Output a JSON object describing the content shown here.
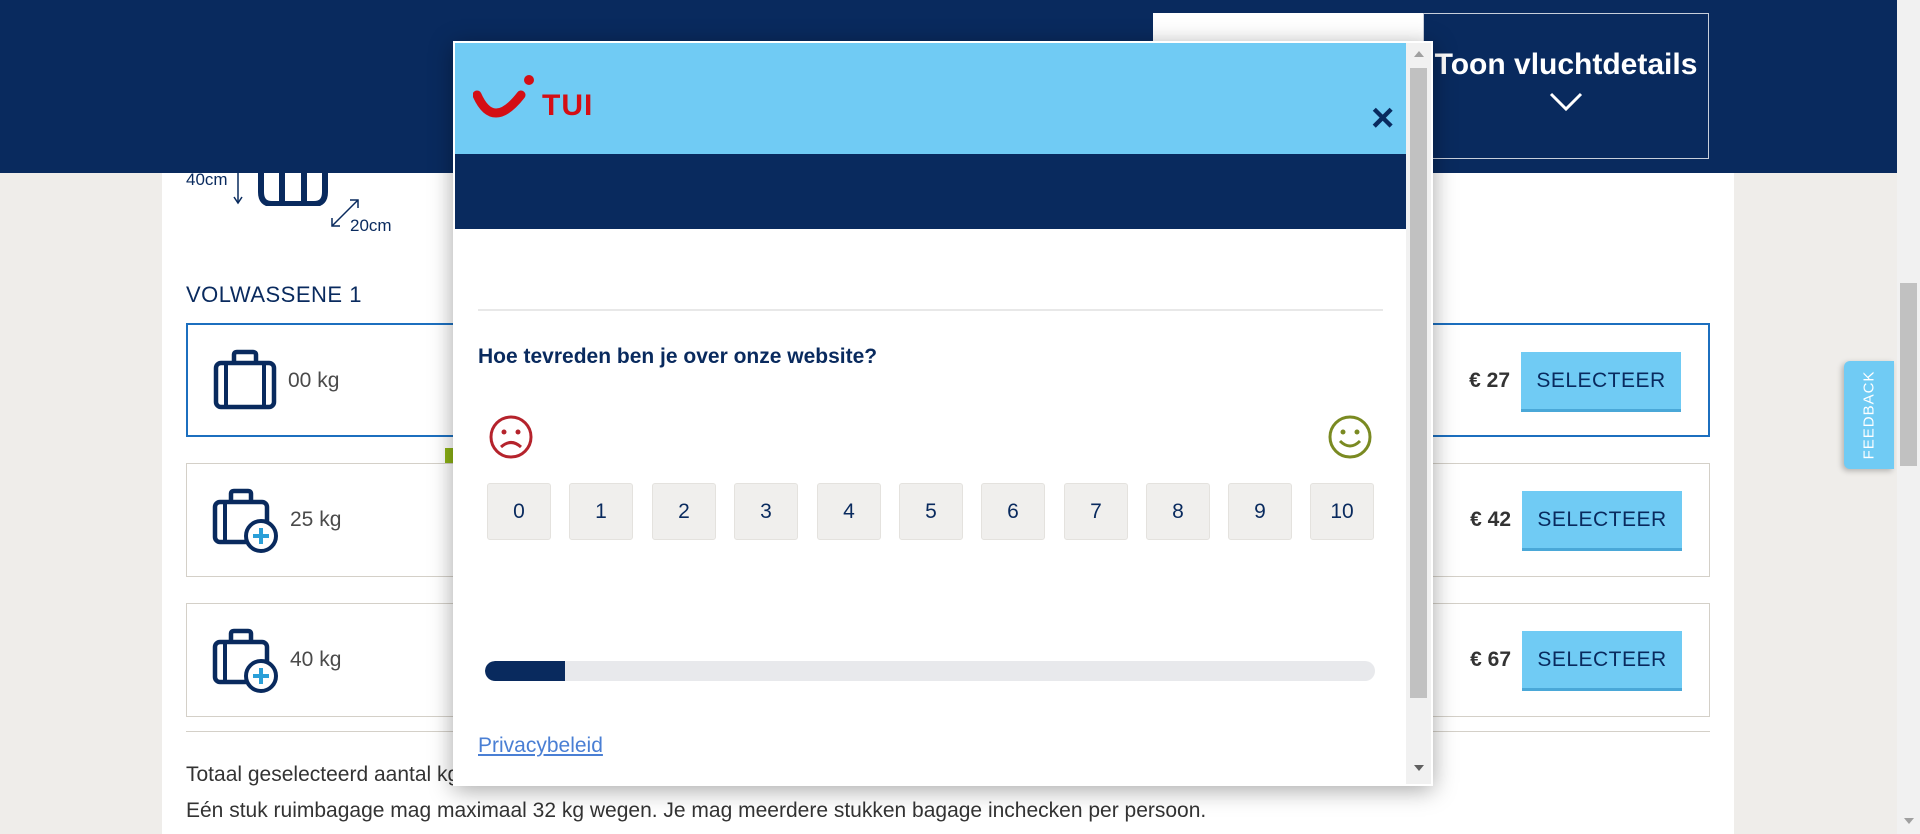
{
  "header": {
    "flight_details_label": "Toon vluchtdetails"
  },
  "luggage": {
    "dim_height": "40cm",
    "dim_depth": "20cm",
    "section_title": "VOLWASSENE 1",
    "options": [
      {
        "weight": "00 kg",
        "price": "€ 27",
        "button": "SELECTEER",
        "selected": true,
        "icon": "suitcase-icon"
      },
      {
        "weight": "25 kg",
        "price": "€ 42",
        "button": "SELECTEER",
        "selected": false,
        "icon": "suitcase-plus-icon"
      },
      {
        "weight": "40 kg",
        "price": "€ 67",
        "button": "SELECTEER",
        "selected": false,
        "icon": "suitcase-plus-icon"
      }
    ],
    "summary_total": "Totaal geselecteerd aantal kg",
    "summary_note": "Eén stuk ruimbagage mag maximaal 32 kg wegen. Je mag meerdere stukken bagage inchecken per persoon."
  },
  "feedback_tab": {
    "label": "FEEDBACK"
  },
  "survey": {
    "logo_text": "TUI",
    "close_label": "×",
    "question": "Hoe tevreden ben je over onze website?",
    "scale": [
      "0",
      "1",
      "2",
      "3",
      "4",
      "5",
      "6",
      "7",
      "8",
      "9",
      "10"
    ],
    "sad_icon": "sad-face-icon",
    "happy_icon": "happy-face-icon",
    "progress": 0.09,
    "privacy_link": "Privacybeleid"
  },
  "colors": {
    "navy": "#092a5e",
    "sky": "#70cbf4",
    "tui_red": "#d40e14",
    "sad_red": "#b5232c",
    "happy_green": "#7a8a22"
  }
}
